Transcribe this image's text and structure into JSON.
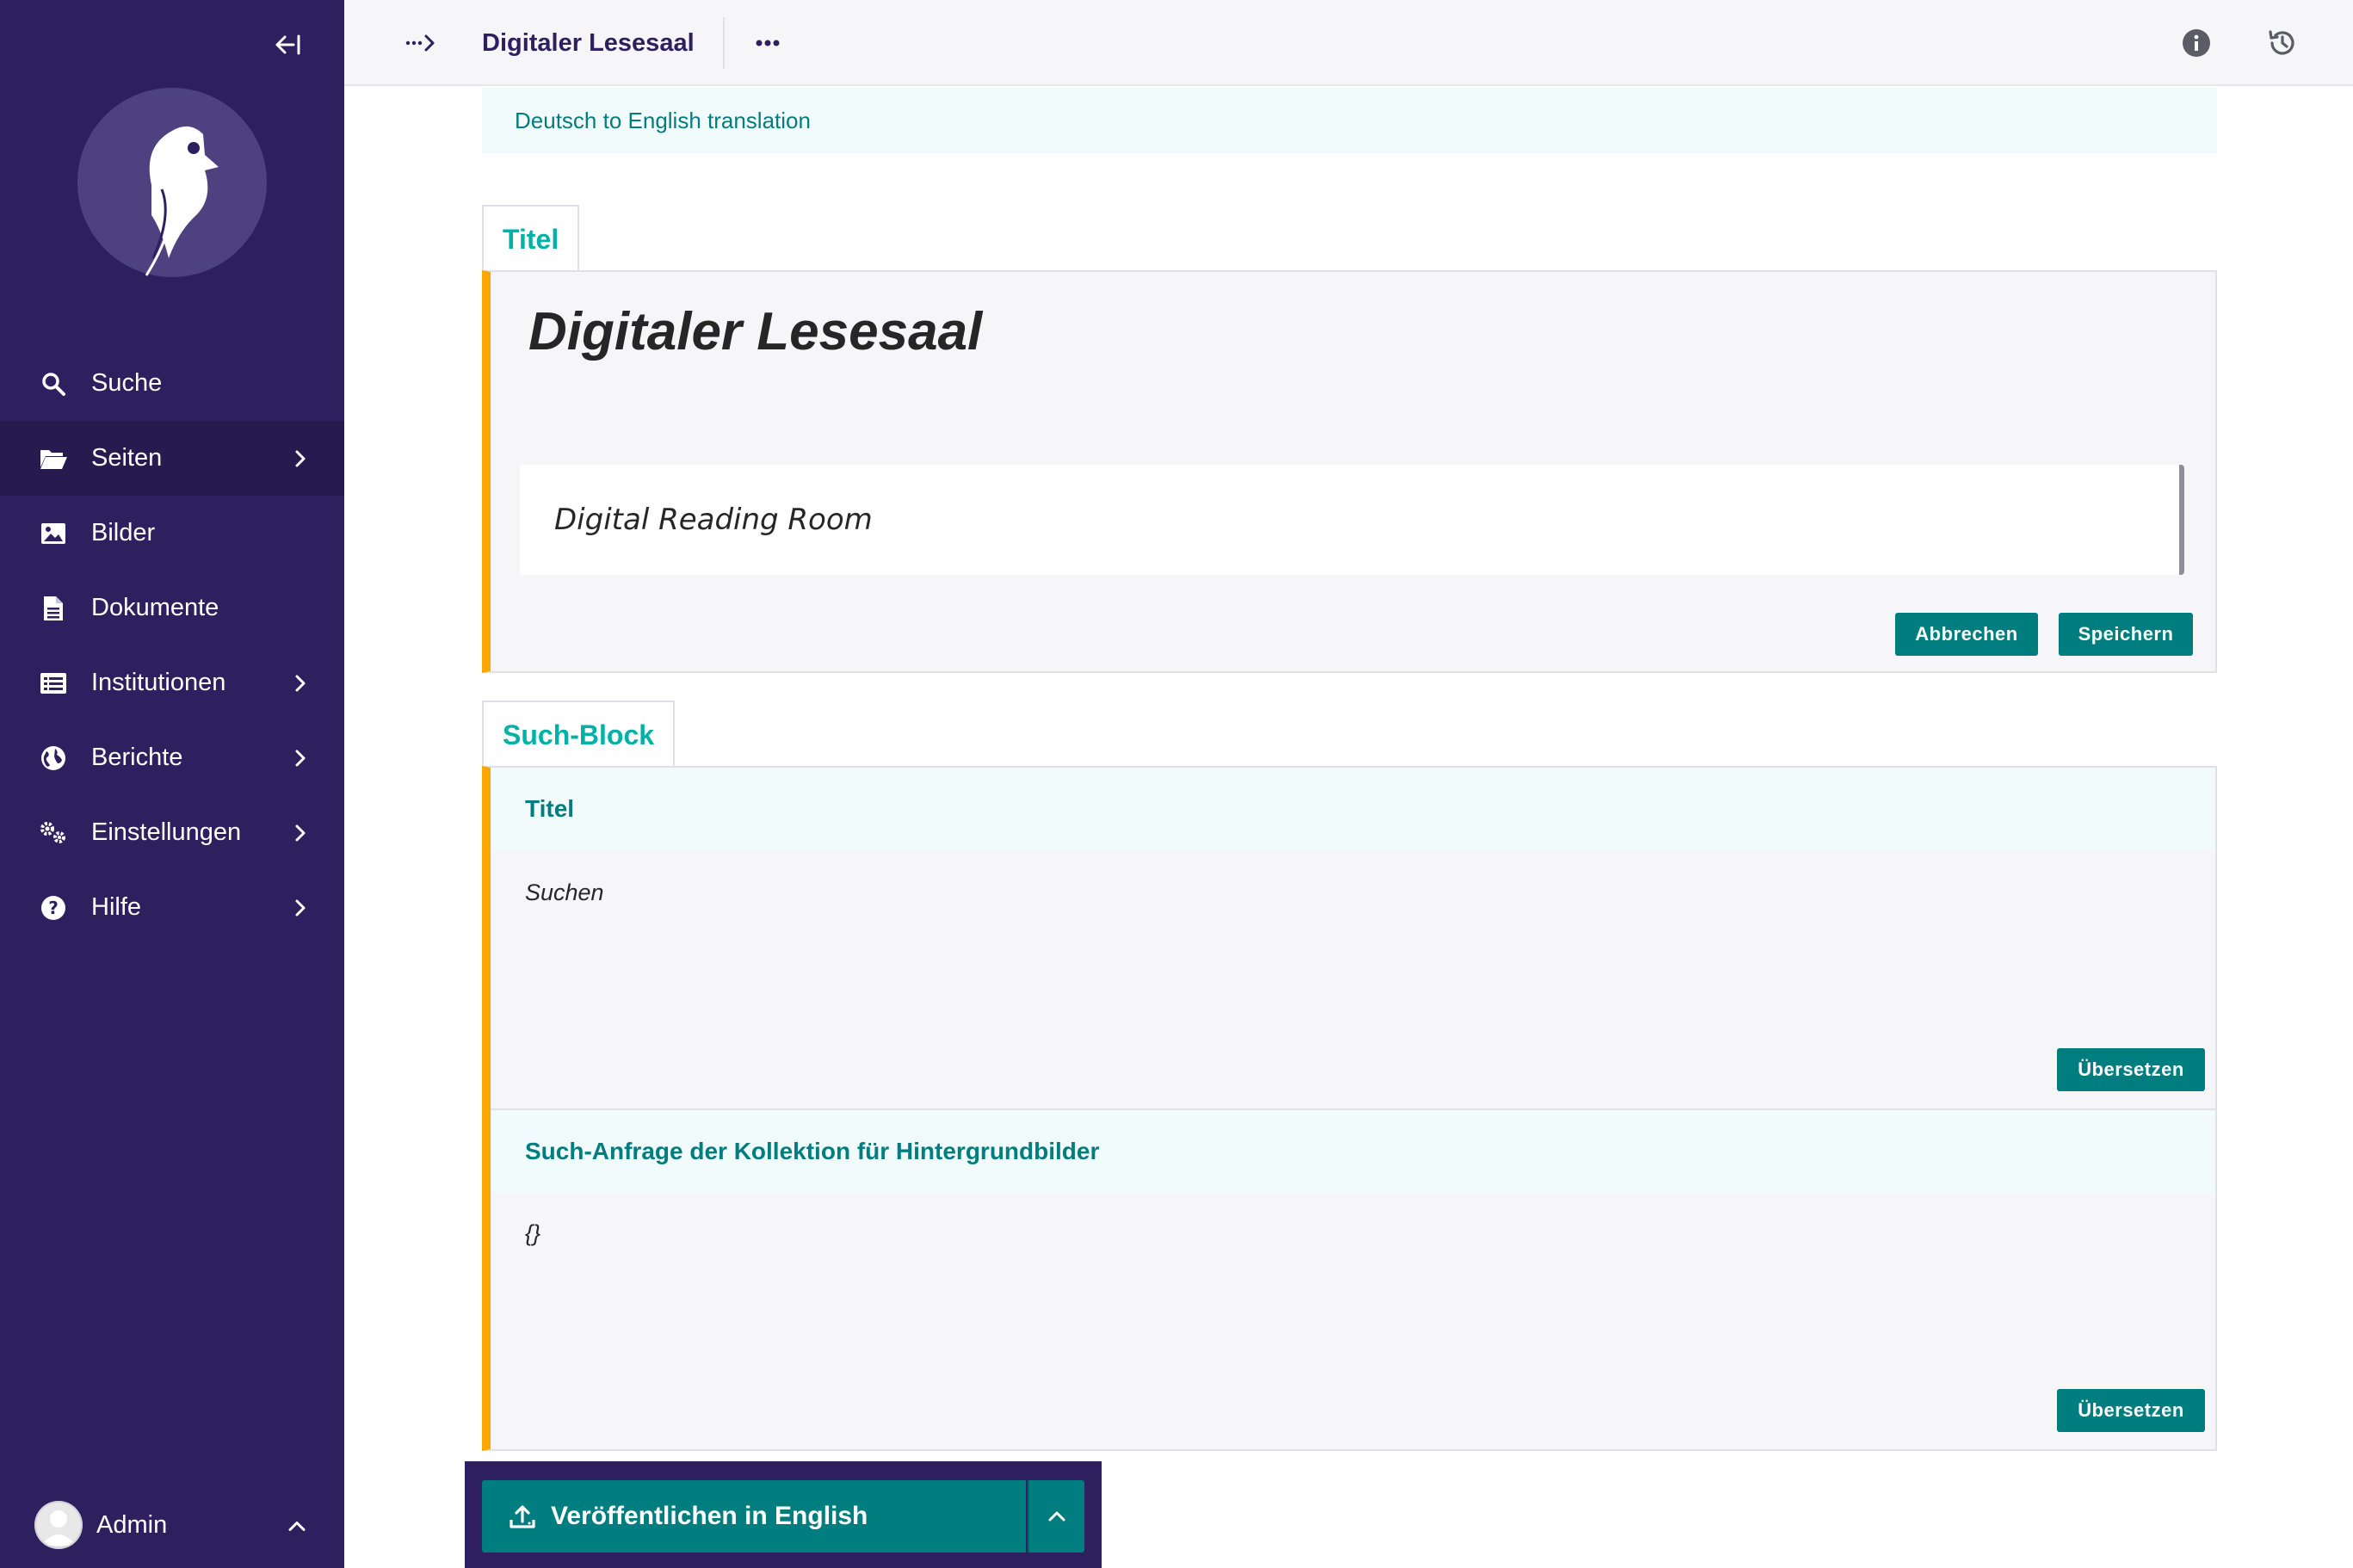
{
  "sidebar": {
    "items": [
      {
        "label": "Suche",
        "icon": "search-icon"
      },
      {
        "label": "Seiten",
        "icon": "folder-open-icon"
      },
      {
        "label": "Bilder",
        "icon": "image-icon"
      },
      {
        "label": "Dokumente",
        "icon": "document-icon"
      },
      {
        "label": "Institutionen",
        "icon": "list-icon"
      },
      {
        "label": "Berichte",
        "icon": "globe-icon"
      },
      {
        "label": "Einstellungen",
        "icon": "cogs-icon"
      },
      {
        "label": "Hilfe",
        "icon": "help-icon"
      }
    ],
    "account": {
      "label": "Admin"
    }
  },
  "header": {
    "title": "Digitaler Lesesaal",
    "breadcrumb_toggle": "···>"
  },
  "main": {
    "locale_banner": "Deutsch to English translation",
    "title_block": {
      "tab_label": "Titel",
      "source_text": "Digitaler Lesesaal",
      "translation_value": "Digital Reading Room",
      "cancel_label": "Abbrechen",
      "save_label": "Speichern"
    },
    "search_block": {
      "tab_label": "Such-Block",
      "fields": [
        {
          "label": "Titel",
          "value": "Suchen",
          "button_label": "Übersetzen"
        },
        {
          "label": "Such-Anfrage der Kollektion für Hintergrundbilder",
          "value": "{}",
          "button_label": "Übersetzen"
        }
      ]
    }
  },
  "footer": {
    "publish_label": "Veröffentlichen in English"
  },
  "colors": {
    "sidebar": "#2e1f5e",
    "accent": "#007d7e",
    "tab_text": "#00b1a7",
    "panel_border": "#faa700"
  }
}
